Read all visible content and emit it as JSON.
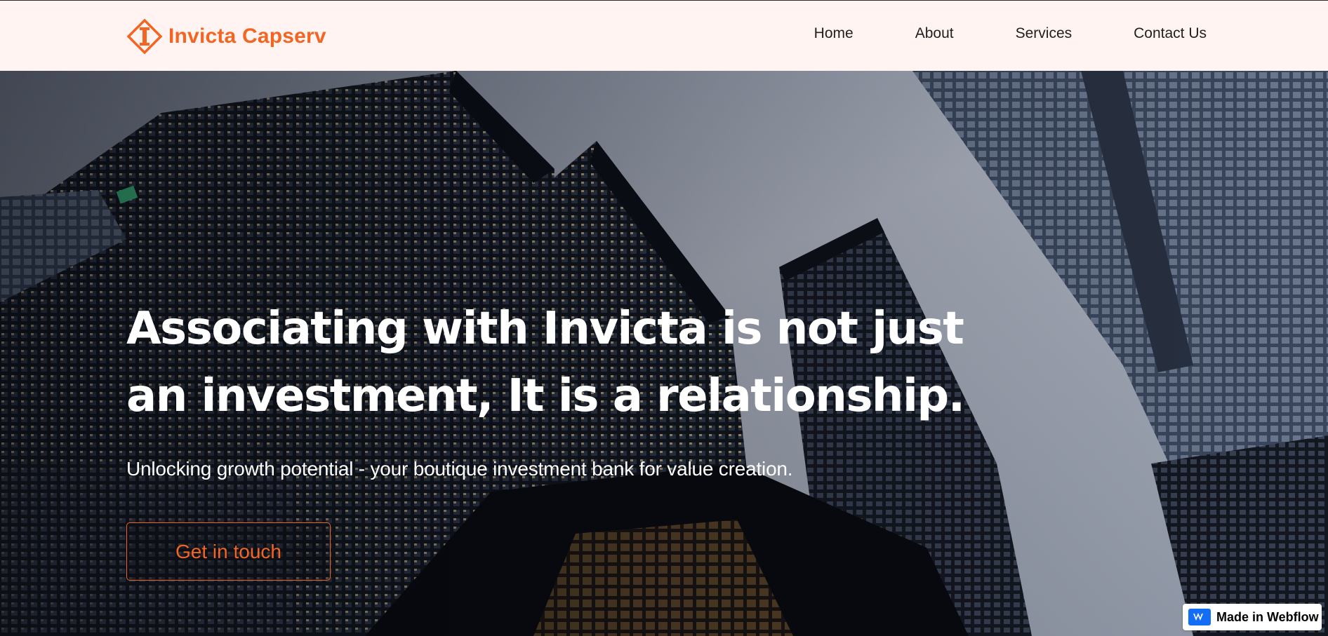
{
  "brand": {
    "name": "Invicta Capserv",
    "logo_icon": "invicta-logo-icon",
    "color": "#f26522"
  },
  "nav": {
    "items": [
      {
        "label": "Home"
      },
      {
        "label": "About"
      },
      {
        "label": "Services"
      },
      {
        "label": "Contact Us"
      }
    ]
  },
  "hero": {
    "title": "Associating with Invicta is not just an investment, It is a relationship.",
    "subtitle": "Unlocking growth potential - your boutique investment bank for value creation.",
    "cta_label": "Get in touch",
    "background": "skyscrapers-photo"
  },
  "badge": {
    "label": "Made in Webflow",
    "icon": "webflow-icon"
  },
  "colors": {
    "accent": "#f26522",
    "nav_bg": "#fff4f1"
  }
}
